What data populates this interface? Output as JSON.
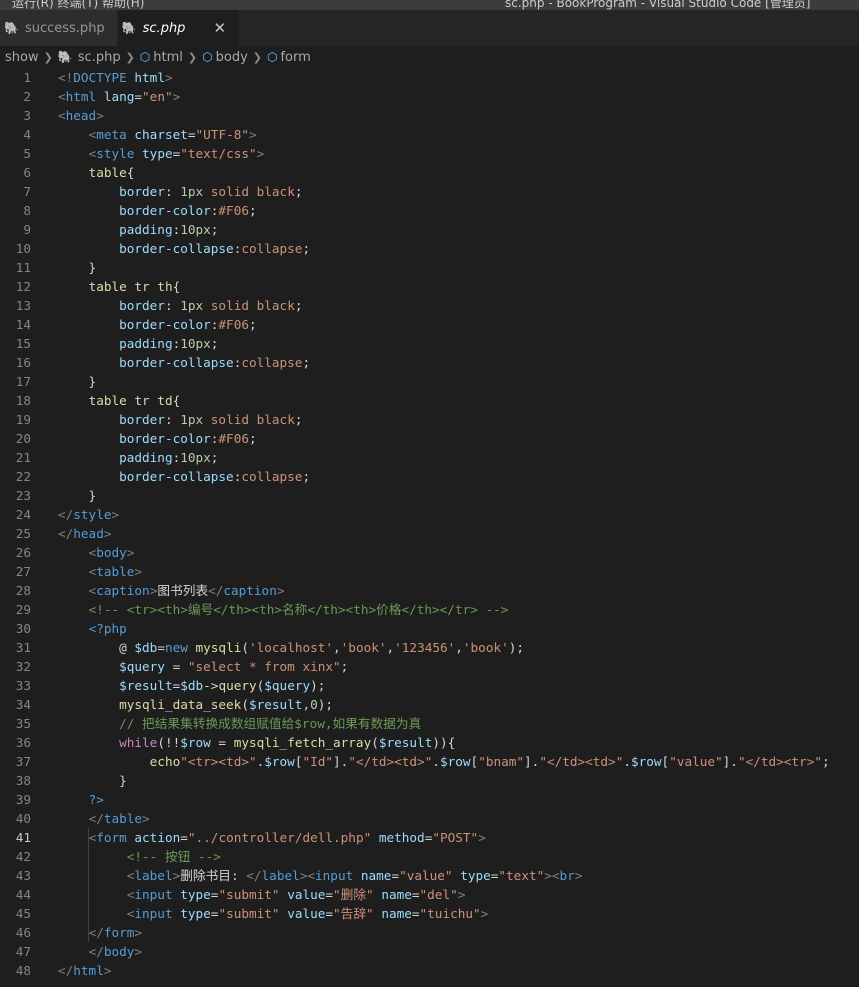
{
  "window": {
    "menu": "运行(R) 终端(T) 帮助(H)",
    "title": "sc.php - BookProgram - Visual Studio Code [管理员]"
  },
  "tabs": [
    {
      "label": "success.php",
      "active": false
    },
    {
      "label": "sc.php",
      "active": true,
      "close": "✕"
    }
  ],
  "breadcrumb": [
    "show",
    "sc.php",
    "html",
    "body",
    "form"
  ],
  "editor": {
    "current_line": 41,
    "lines": [
      [
        [
          "t",
          "<!"
        ],
        [
          "tn",
          "DOCTYPE"
        ],
        [
          "w",
          " "
        ],
        [
          "at",
          "html"
        ],
        [
          "t",
          ">"
        ]
      ],
      [
        [
          "t",
          "<"
        ],
        [
          "tn",
          "html"
        ],
        [
          "w",
          " "
        ],
        [
          "at",
          "lang"
        ],
        [
          "w",
          "="
        ],
        [
          "s",
          "\"en\""
        ],
        [
          "t",
          ">"
        ]
      ],
      [
        [
          "t",
          "<"
        ],
        [
          "tn",
          "head"
        ],
        [
          "t",
          ">"
        ]
      ],
      [
        [
          "w",
          "    "
        ],
        [
          "t",
          "<"
        ],
        [
          "tn",
          "meta"
        ],
        [
          "w",
          " "
        ],
        [
          "at",
          "charset"
        ],
        [
          "w",
          "="
        ],
        [
          "s",
          "\"UTF-8\""
        ],
        [
          "t",
          ">"
        ]
      ],
      [
        [
          "w",
          "    "
        ],
        [
          "t",
          "<"
        ],
        [
          "tn",
          "style"
        ],
        [
          "w",
          " "
        ],
        [
          "at",
          "type"
        ],
        [
          "w",
          "="
        ],
        [
          "s",
          "\"text/css\""
        ],
        [
          "t",
          ">"
        ]
      ],
      [
        [
          "w",
          "    "
        ],
        [
          "f",
          "table"
        ],
        [
          "w",
          "{"
        ]
      ],
      [
        [
          "w",
          "        "
        ],
        [
          "at",
          "border"
        ],
        [
          "w",
          ": "
        ],
        [
          "n",
          "1px"
        ],
        [
          "w",
          " "
        ],
        [
          "s",
          "solid"
        ],
        [
          "w",
          " "
        ],
        [
          "s",
          "black"
        ],
        [
          "w",
          ";"
        ]
      ],
      [
        [
          "w",
          "        "
        ],
        [
          "at",
          "border-color"
        ],
        [
          "w",
          ":"
        ],
        [
          "s",
          "#F06"
        ],
        [
          "w",
          ";"
        ]
      ],
      [
        [
          "w",
          "        "
        ],
        [
          "at",
          "padding"
        ],
        [
          "w",
          ":"
        ],
        [
          "n",
          "10px"
        ],
        [
          "w",
          ";"
        ]
      ],
      [
        [
          "w",
          "        "
        ],
        [
          "at",
          "border-collapse"
        ],
        [
          "w",
          ":"
        ],
        [
          "s",
          "collapse"
        ],
        [
          "w",
          ";"
        ]
      ],
      [
        [
          "w",
          "    }"
        ]
      ],
      [
        [
          "w",
          "    "
        ],
        [
          "f",
          "table tr th"
        ],
        [
          "w",
          "{"
        ]
      ],
      [
        [
          "w",
          "        "
        ],
        [
          "at",
          "border"
        ],
        [
          "w",
          ": "
        ],
        [
          "n",
          "1px"
        ],
        [
          "w",
          " "
        ],
        [
          "s",
          "solid"
        ],
        [
          "w",
          " "
        ],
        [
          "s",
          "black"
        ],
        [
          "w",
          ";"
        ]
      ],
      [
        [
          "w",
          "        "
        ],
        [
          "at",
          "border-color"
        ],
        [
          "w",
          ":"
        ],
        [
          "s",
          "#F06"
        ],
        [
          "w",
          ";"
        ]
      ],
      [
        [
          "w",
          "        "
        ],
        [
          "at",
          "padding"
        ],
        [
          "w",
          ":"
        ],
        [
          "n",
          "10px"
        ],
        [
          "w",
          ";"
        ]
      ],
      [
        [
          "w",
          "        "
        ],
        [
          "at",
          "border-collapse"
        ],
        [
          "w",
          ":"
        ],
        [
          "s",
          "collapse"
        ],
        [
          "w",
          ";"
        ]
      ],
      [
        [
          "w",
          "    }"
        ]
      ],
      [
        [
          "w",
          "    "
        ],
        [
          "f",
          "table tr td"
        ],
        [
          "w",
          "{"
        ]
      ],
      [
        [
          "w",
          "        "
        ],
        [
          "at",
          "border"
        ],
        [
          "w",
          ": "
        ],
        [
          "n",
          "1px"
        ],
        [
          "w",
          " "
        ],
        [
          "s",
          "solid"
        ],
        [
          "w",
          " "
        ],
        [
          "s",
          "black"
        ],
        [
          "w",
          ";"
        ]
      ],
      [
        [
          "w",
          "        "
        ],
        [
          "at",
          "border-color"
        ],
        [
          "w",
          ":"
        ],
        [
          "s",
          "#F06"
        ],
        [
          "w",
          ";"
        ]
      ],
      [
        [
          "w",
          "        "
        ],
        [
          "at",
          "padding"
        ],
        [
          "w",
          ":"
        ],
        [
          "n",
          "10px"
        ],
        [
          "w",
          ";"
        ]
      ],
      [
        [
          "w",
          "        "
        ],
        [
          "at",
          "border-collapse"
        ],
        [
          "w",
          ":"
        ],
        [
          "s",
          "collapse"
        ],
        [
          "w",
          ";"
        ]
      ],
      [
        [
          "w",
          "    }"
        ]
      ],
      [
        [
          "t",
          "</"
        ],
        [
          "tn",
          "style"
        ],
        [
          "t",
          ">"
        ]
      ],
      [
        [
          "t",
          "</"
        ],
        [
          "tn",
          "head"
        ],
        [
          "t",
          ">"
        ]
      ],
      [
        [
          "w",
          "    "
        ],
        [
          "t",
          "<"
        ],
        [
          "tn",
          "body"
        ],
        [
          "t",
          ">"
        ]
      ],
      [
        [
          "w",
          "    "
        ],
        [
          "t",
          "<"
        ],
        [
          "tn",
          "table"
        ],
        [
          "t",
          ">"
        ]
      ],
      [
        [
          "w",
          "    "
        ],
        [
          "t",
          "<"
        ],
        [
          "tn",
          "caption"
        ],
        [
          "t",
          ">"
        ],
        [
          "w",
          "图书列表"
        ],
        [
          "t",
          "</"
        ],
        [
          "tn",
          "caption"
        ],
        [
          "t",
          ">"
        ]
      ],
      [
        [
          "w",
          "    "
        ],
        [
          "c",
          "<!-- <tr><th>编号</th><th>名称</th><th>价格</th></tr> -->"
        ]
      ],
      [
        [
          "w",
          "    "
        ],
        [
          "b",
          "<?php"
        ]
      ],
      [
        [
          "w",
          "        @ "
        ],
        [
          "v",
          "$db"
        ],
        [
          "w",
          "="
        ],
        [
          "b",
          "new"
        ],
        [
          "w",
          " "
        ],
        [
          "f",
          "mysqli"
        ],
        [
          "w",
          "("
        ],
        [
          "s",
          "'localhost'"
        ],
        [
          "w",
          ","
        ],
        [
          "s",
          "'book'"
        ],
        [
          "w",
          ","
        ],
        [
          "s",
          "'123456'"
        ],
        [
          "w",
          ","
        ],
        [
          "s",
          "'book'"
        ],
        [
          "w",
          ");"
        ]
      ],
      [
        [
          "w",
          "        "
        ],
        [
          "v",
          "$query"
        ],
        [
          "w",
          " = "
        ],
        [
          "s",
          "\"select * from xinx\""
        ],
        [
          "w",
          ";"
        ]
      ],
      [
        [
          "w",
          "        "
        ],
        [
          "v",
          "$result"
        ],
        [
          "w",
          "="
        ],
        [
          "v",
          "$db"
        ],
        [
          "w",
          "->"
        ],
        [
          "f",
          "query"
        ],
        [
          "w",
          "("
        ],
        [
          "v",
          "$query"
        ],
        [
          "w",
          ");"
        ]
      ],
      [
        [
          "w",
          "        "
        ],
        [
          "f",
          "mysqli_data_seek"
        ],
        [
          "w",
          "("
        ],
        [
          "v",
          "$result"
        ],
        [
          "w",
          ","
        ],
        [
          "n",
          "0"
        ],
        [
          "w",
          ");"
        ]
      ],
      [
        [
          "w",
          "        "
        ],
        [
          "c",
          "// 把结果集转换成数组赋值给$row,如果有数据为真"
        ]
      ],
      [
        [
          "w",
          "        "
        ],
        [
          "k",
          "while"
        ],
        [
          "w",
          "(!!"
        ],
        [
          "v",
          "$row"
        ],
        [
          "w",
          " = "
        ],
        [
          "f",
          "mysqli_fetch_array"
        ],
        [
          "w",
          "("
        ],
        [
          "v",
          "$result"
        ],
        [
          "w",
          ")){"
        ]
      ],
      [
        [
          "w",
          "            "
        ],
        [
          "f",
          "echo"
        ],
        [
          "s",
          "\"<tr><td>\""
        ],
        [
          "w",
          "."
        ],
        [
          "v",
          "$row"
        ],
        [
          "w",
          "["
        ],
        [
          "s",
          "\"Id\""
        ],
        [
          "w",
          "]."
        ],
        [
          "s",
          "\"</td><td>\""
        ],
        [
          "w",
          "."
        ],
        [
          "v",
          "$row"
        ],
        [
          "w",
          "["
        ],
        [
          "s",
          "\"bnam\""
        ],
        [
          "w",
          "]."
        ],
        [
          "s",
          "\"</td><td>\""
        ],
        [
          "w",
          "."
        ],
        [
          "v",
          "$row"
        ],
        [
          "w",
          "["
        ],
        [
          "s",
          "\"value\""
        ],
        [
          "w",
          "]."
        ],
        [
          "s",
          "\"</td><tr>\""
        ],
        [
          "w",
          ";"
        ]
      ],
      [
        [
          "w",
          "        }"
        ]
      ],
      [
        [
          "w",
          "    "
        ],
        [
          "b",
          "?>"
        ]
      ],
      [
        [
          "w",
          "    "
        ],
        [
          "t",
          "</"
        ],
        [
          "tn",
          "table"
        ],
        [
          "t",
          ">"
        ]
      ],
      [
        [
          "w",
          "    "
        ],
        [
          "t",
          "<"
        ],
        [
          "tn",
          "form"
        ],
        [
          "w",
          " "
        ],
        [
          "at",
          "action"
        ],
        [
          "w",
          "="
        ],
        [
          "s",
          "\"../controller/dell.php\""
        ],
        [
          "w",
          " "
        ],
        [
          "at",
          "method"
        ],
        [
          "w",
          "="
        ],
        [
          "s",
          "\"POST\""
        ],
        [
          "t",
          ">"
        ]
      ],
      [
        [
          "w",
          "         "
        ],
        [
          "c",
          "<!-- 按钮 -->"
        ]
      ],
      [
        [
          "w",
          "         "
        ],
        [
          "t",
          "<"
        ],
        [
          "tn",
          "label"
        ],
        [
          "t",
          ">"
        ],
        [
          "w",
          "删除书目: "
        ],
        [
          "t",
          "</"
        ],
        [
          "tn",
          "label"
        ],
        [
          "t",
          "><"
        ],
        [
          "tn",
          "input"
        ],
        [
          "w",
          " "
        ],
        [
          "at",
          "name"
        ],
        [
          "w",
          "="
        ],
        [
          "s",
          "\"value\""
        ],
        [
          "w",
          " "
        ],
        [
          "at",
          "type"
        ],
        [
          "w",
          "="
        ],
        [
          "s",
          "\"text\""
        ],
        [
          "t",
          "><"
        ],
        [
          "tn",
          "br"
        ],
        [
          "t",
          ">"
        ]
      ],
      [
        [
          "w",
          "         "
        ],
        [
          "t",
          "<"
        ],
        [
          "tn",
          "input"
        ],
        [
          "w",
          " "
        ],
        [
          "at",
          "type"
        ],
        [
          "w",
          "="
        ],
        [
          "s",
          "\"submit\""
        ],
        [
          "w",
          " "
        ],
        [
          "at",
          "value"
        ],
        [
          "w",
          "="
        ],
        [
          "s",
          "\"删除\""
        ],
        [
          "w",
          " "
        ],
        [
          "at",
          "name"
        ],
        [
          "w",
          "="
        ],
        [
          "s",
          "\"del\""
        ],
        [
          "t",
          ">"
        ]
      ],
      [
        [
          "w",
          "         "
        ],
        [
          "t",
          "<"
        ],
        [
          "tn",
          "input"
        ],
        [
          "w",
          " "
        ],
        [
          "at",
          "type"
        ],
        [
          "w",
          "="
        ],
        [
          "s",
          "\"submit\""
        ],
        [
          "w",
          " "
        ],
        [
          "at",
          "value"
        ],
        [
          "w",
          "="
        ],
        [
          "s",
          "\"告辞\""
        ],
        [
          "w",
          " "
        ],
        [
          "at",
          "name"
        ],
        [
          "w",
          "="
        ],
        [
          "s",
          "\"tuichu\""
        ],
        [
          "t",
          ">"
        ]
      ],
      [
        [
          "w",
          "    "
        ],
        [
          "t",
          "</"
        ],
        [
          "tn",
          "form"
        ],
        [
          "t",
          ">"
        ]
      ],
      [
        [
          "w",
          "    "
        ],
        [
          "t",
          "</"
        ],
        [
          "tn",
          "body"
        ],
        [
          "t",
          ">"
        ]
      ],
      [
        [
          "t",
          "</"
        ],
        [
          "tn",
          "html"
        ],
        [
          "t",
          ">"
        ]
      ]
    ]
  }
}
